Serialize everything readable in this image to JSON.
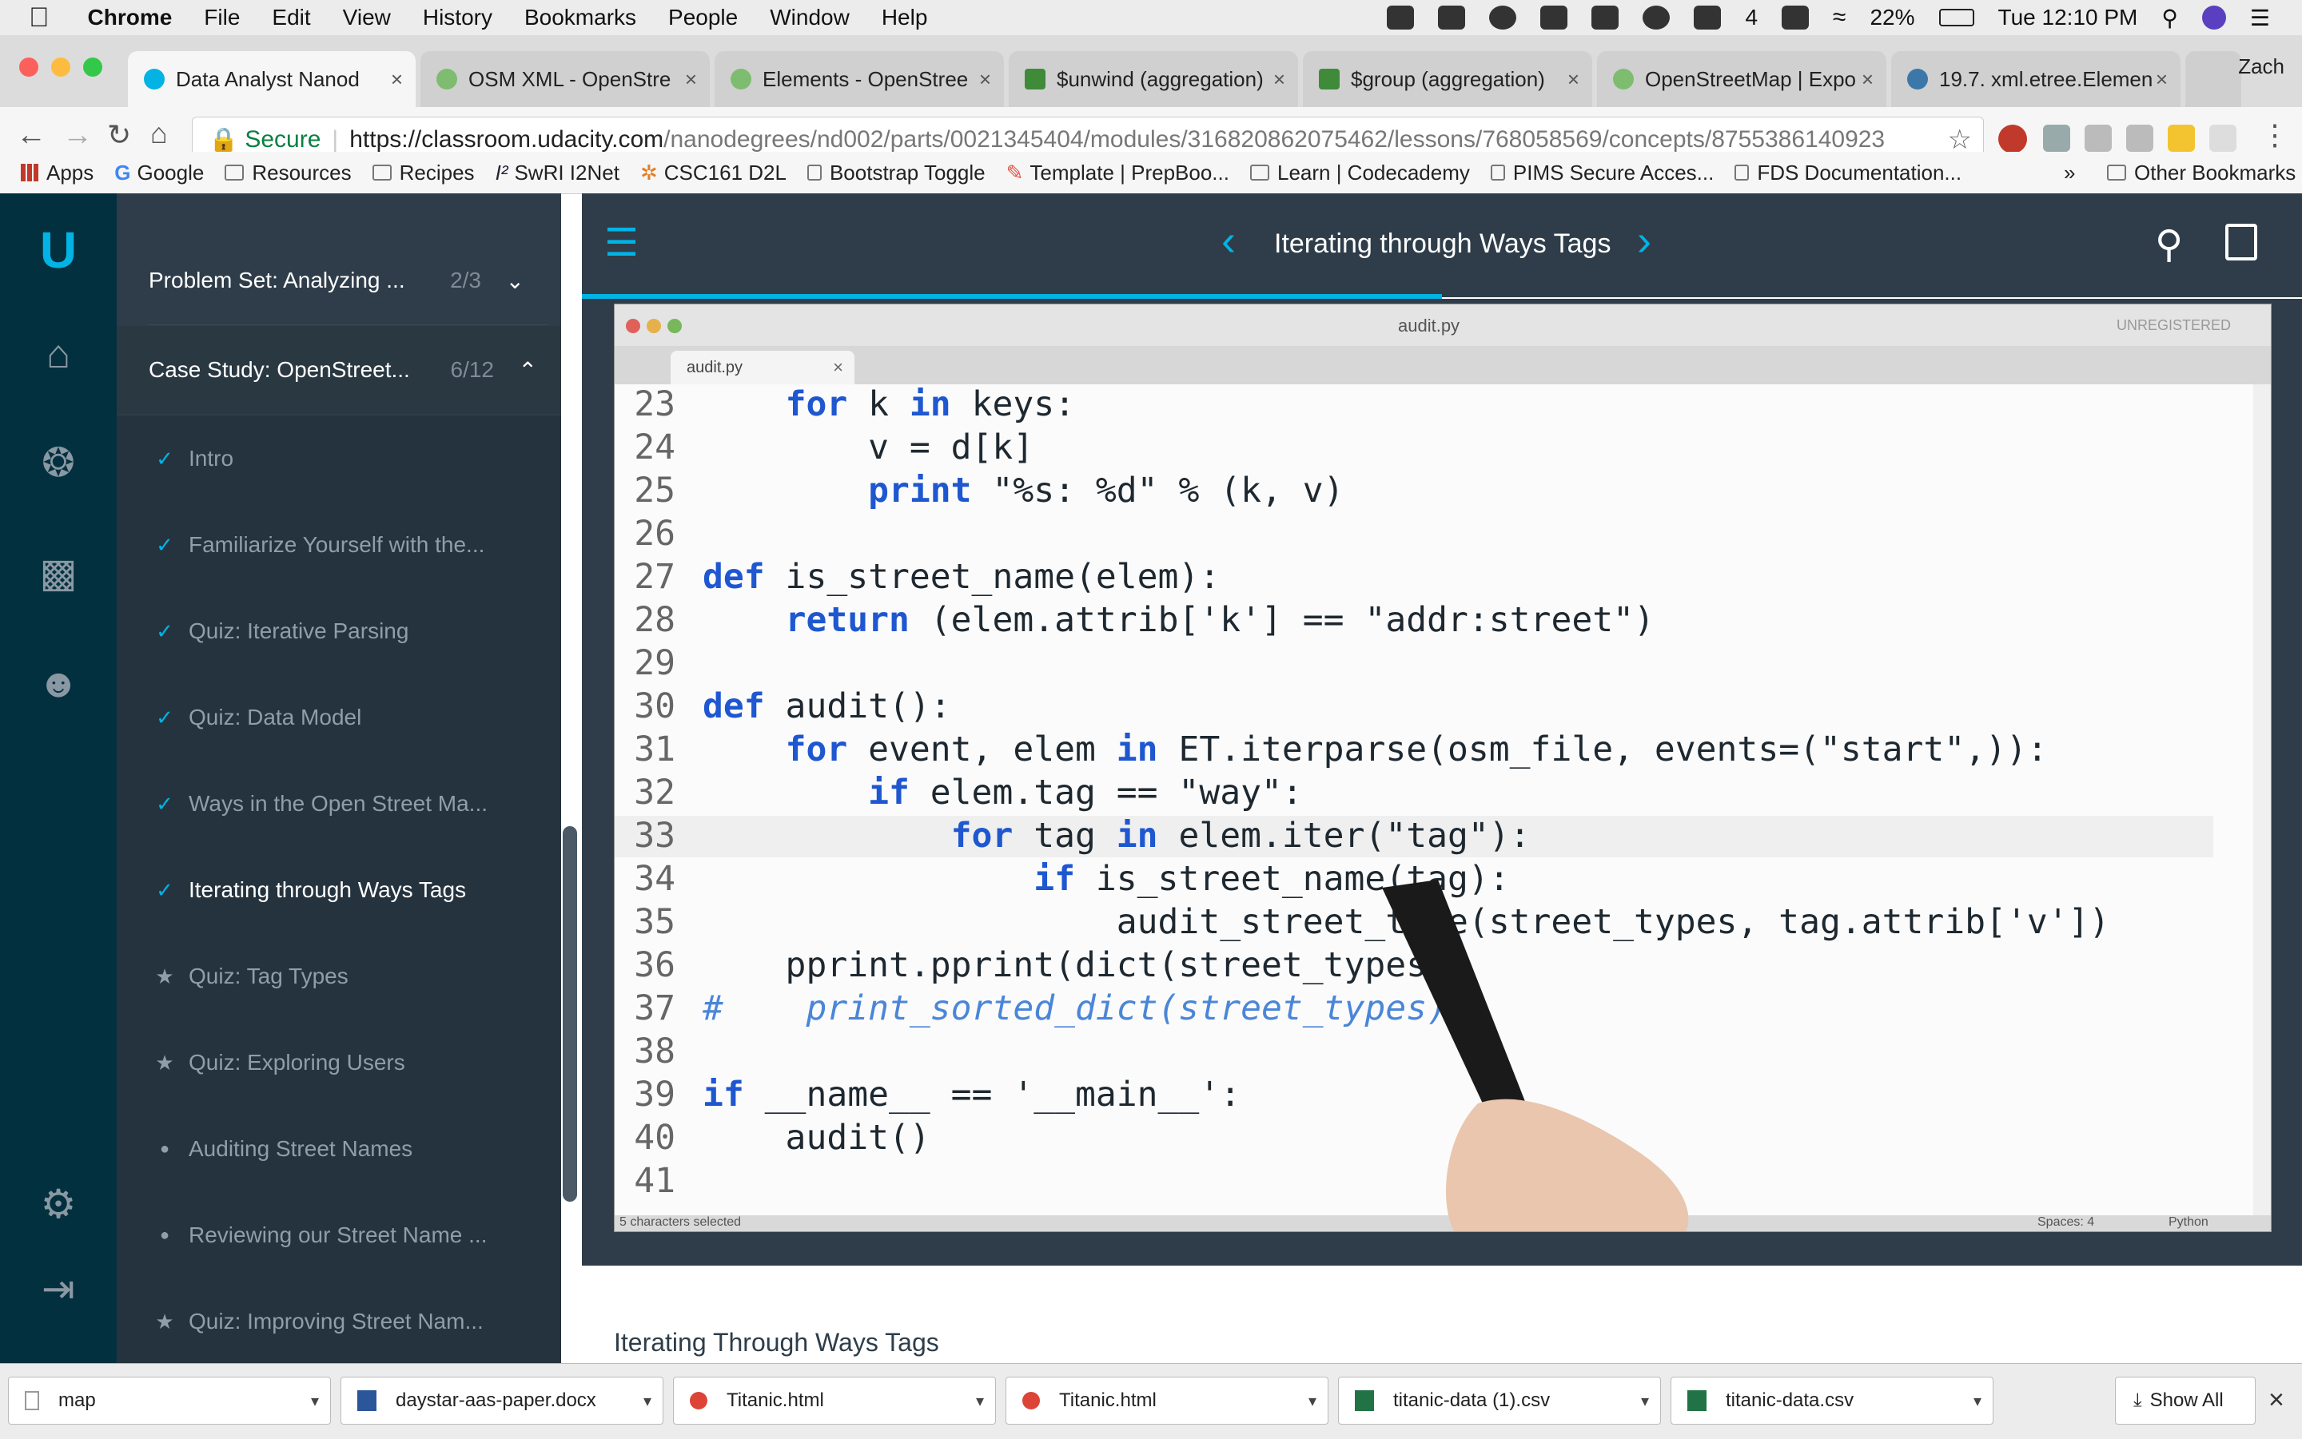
{
  "menubar": {
    "app": "Chrome",
    "items": [
      "File",
      "Edit",
      "View",
      "History",
      "Bookmarks",
      "People",
      "Window",
      "Help"
    ],
    "battery": "22%",
    "clock": "Tue 12:10 PM",
    "badge_count": "4"
  },
  "browser": {
    "profile": "Zach",
    "tabs": [
      {
        "title": "Data Analyst Nanod",
        "active": true
      },
      {
        "title": "OSM XML - OpenStre"
      },
      {
        "title": "Elements - OpenStree"
      },
      {
        "title": "$unwind (aggregation)"
      },
      {
        "title": "$group (aggregation)"
      },
      {
        "title": "OpenStreetMap | Expo"
      },
      {
        "title": "19.7. xml.etree.Elemen"
      }
    ],
    "secure_label": "Secure",
    "url_host": "https://classroom.udacity.com",
    "url_path": "/nanodegrees/nd002/parts/0021345404/modules/316820862075462/lessons/768058569/concepts/8755386140923",
    "bookmarks": [
      "Apps",
      "Google",
      "Resources",
      "Recipes",
      "SwRI I2Net",
      "CSC161 D2L",
      "Bootstrap Toggle",
      "Template | PrepBoo...",
      "Learn | Codecademy",
      "PIMS Secure Acces...",
      "FDS Documentation..."
    ],
    "other_bookmarks": "Other Bookmarks"
  },
  "sidebar": {
    "sections": [
      {
        "title": "Problem Set: Analyzing ...",
        "count": "2/3"
      },
      {
        "title": "Case Study: OpenStreet...",
        "count": "6/12"
      }
    ],
    "items": [
      {
        "label": "Intro",
        "mark": "✓"
      },
      {
        "label": "Familiarize Yourself with the...",
        "mark": "✓"
      },
      {
        "label": "Quiz: Iterative Parsing",
        "mark": "✓"
      },
      {
        "label": "Quiz: Data Model",
        "mark": "✓"
      },
      {
        "label": "Ways in the Open Street Ma...",
        "mark": "✓"
      },
      {
        "label": "Iterating through Ways Tags",
        "mark": "✓"
      },
      {
        "label": "Quiz: Tag Types",
        "mark": "★"
      },
      {
        "label": "Quiz: Exploring Users",
        "mark": "★"
      },
      {
        "label": "Auditing Street Names",
        "mark": "●"
      },
      {
        "label": "Reviewing our Street Name ...",
        "mark": "●"
      },
      {
        "label": "Quiz: Improving Street Nam...",
        "mark": "★"
      }
    ]
  },
  "header": {
    "title": "Iterating through Ways Tags"
  },
  "editor": {
    "window_title": "audit.py",
    "unregistered": "UNREGISTERED",
    "tab": "audit.py",
    "status_left": "5 characters selected",
    "status_spaces": "Spaces: 4",
    "status_lang": "Python",
    "lines": [
      {
        "n": "23",
        "text": "    for k in keys:"
      },
      {
        "n": "24",
        "text": "        v = d[k]"
      },
      {
        "n": "25",
        "text": "        print \"%s: %d\" % (k, v)"
      },
      {
        "n": "26",
        "text": ""
      },
      {
        "n": "27",
        "text": "def is_street_name(elem):"
      },
      {
        "n": "28",
        "text": "    return (elem.attrib['k'] == \"addr:street\")"
      },
      {
        "n": "29",
        "text": ""
      },
      {
        "n": "30",
        "text": "def audit():"
      },
      {
        "n": "31",
        "text": "    for event, elem in ET.iterparse(osm_file, events=(\"start\",)):"
      },
      {
        "n": "32",
        "text": "        if elem.tag == \"way\":"
      },
      {
        "n": "33",
        "text": "            for tag in elem.iter(\"tag\"):"
      },
      {
        "n": "34",
        "text": "                if is_street_name(tag):"
      },
      {
        "n": "35",
        "text": "                    audit_street_type(street_types, tag.attrib['v'])"
      },
      {
        "n": "36",
        "text": "    pprint.pprint(dict(street_types))"
      },
      {
        "n": "37",
        "text": "#    print_sorted_dict(street_types)"
      },
      {
        "n": "38",
        "text": ""
      },
      {
        "n": "39",
        "text": "if __name__ == '__main__':"
      },
      {
        "n": "40",
        "text": "    audit()"
      },
      {
        "n": "41",
        "text": ""
      }
    ]
  },
  "content": {
    "heading": "Iterating Through Ways Tags"
  },
  "downloads": {
    "files": [
      "map",
      "daystar-aas-paper.docx",
      "Titanic.html",
      "Titanic.html",
      "titanic-data (1).csv",
      "titanic-data.csv"
    ],
    "show_all": "Show All"
  },
  "colors": {
    "accent": "#02b3e4",
    "sidebar": "#2e3d49",
    "rail": "#02303f"
  }
}
